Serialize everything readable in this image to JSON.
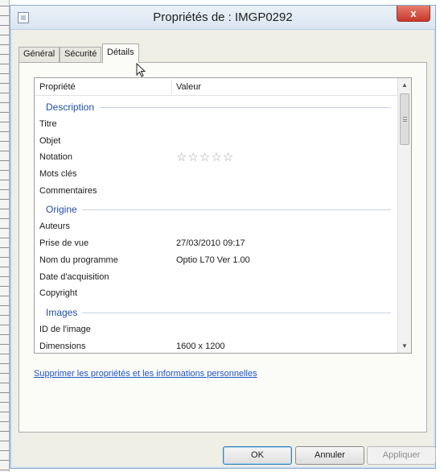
{
  "window": {
    "title": "Propriétés de : IMGP0292",
    "close_label": "x"
  },
  "tabs": [
    {
      "label": "Général"
    },
    {
      "label": "Sécurité"
    },
    {
      "label": "Détails"
    }
  ],
  "table": {
    "headers": {
      "property": "Propriété",
      "value": "Valeur"
    },
    "groups": [
      {
        "name": "Description",
        "rows": [
          {
            "property": "Titre",
            "value": ""
          },
          {
            "property": "Objet",
            "value": ""
          },
          {
            "property": "Notation",
            "value": "",
            "stars_filled": 0,
            "stars_total": 5
          },
          {
            "property": "Mots clés",
            "value": ""
          },
          {
            "property": "Commentaires",
            "value": ""
          }
        ]
      },
      {
        "name": "Origine",
        "rows": [
          {
            "property": "Auteurs",
            "value": ""
          },
          {
            "property": "Prise de vue",
            "value": "27/03/2010 09:17"
          },
          {
            "property": "Nom du programme",
            "value": "Optio L70 Ver 1.00"
          },
          {
            "property": "Date d'acquisition",
            "value": ""
          },
          {
            "property": "Copyright",
            "value": ""
          }
        ]
      },
      {
        "name": "Images",
        "rows": [
          {
            "property": "ID de l'image",
            "value": ""
          },
          {
            "property": "Dimensions",
            "value": "1600 x 1200"
          }
        ]
      }
    ]
  },
  "link_remove": "Supprimer les propriétés et les informations personnelles",
  "buttons": {
    "ok": "OK",
    "cancel": "Annuler",
    "apply": "Appliquer"
  }
}
